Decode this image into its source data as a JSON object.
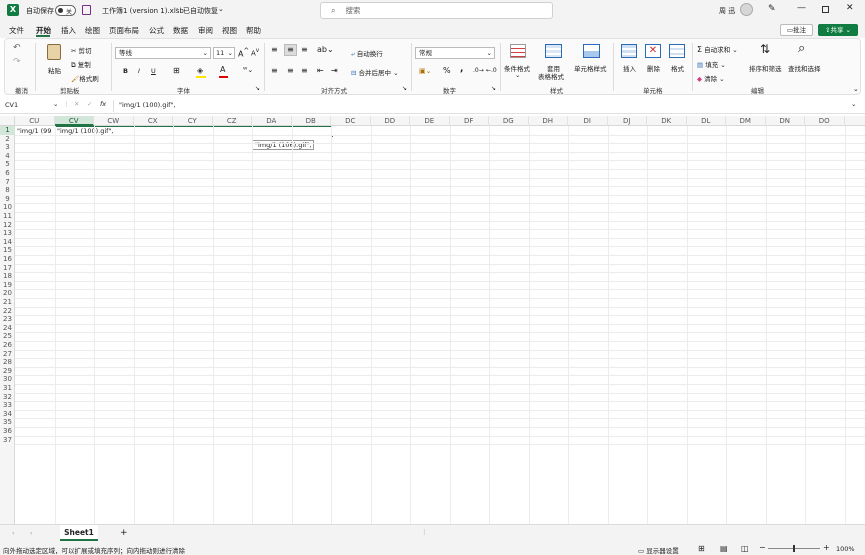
{
  "window": {
    "autosave_label": "自动保存",
    "autosave_state": "关",
    "file_title": "工作簿1 (version 1).xlsb",
    "save_status": "已自动恢复",
    "search_placeholder": "搜索",
    "user_name": "周 迅",
    "user_initial": "周"
  },
  "menu": {
    "items": [
      "文件",
      "开始",
      "插入",
      "绘图",
      "页面布局",
      "公式",
      "数据",
      "审阅",
      "视图",
      "帮助"
    ],
    "active": "开始",
    "comment_label": "批注",
    "share_label": "共享"
  },
  "ribbon": {
    "undo": "撤消",
    "clipboard": {
      "paste": "粘贴",
      "cut": "剪切",
      "copy": "复制",
      "format_painter": "格式刷",
      "label": "剪贴板"
    },
    "font": {
      "name": "等线",
      "size": "11",
      "label": "字体",
      "bold": "B",
      "italic": "I",
      "underline": "U"
    },
    "alignment": {
      "wrap": "自动换行",
      "merge": "合并后居中",
      "label": "对齐方式"
    },
    "number": {
      "format": "常规",
      "label": "数字",
      "percent": "%",
      "comma": ","
    },
    "styles": {
      "cond": "条件格式",
      "table": "套用",
      "table2": "表格格式",
      "cell": "单元格样式",
      "label": "样式"
    },
    "cells": {
      "insert": "插入",
      "delete": "删除",
      "format": "格式",
      "label": "单元格"
    },
    "editing": {
      "autosum": "自动求和",
      "fill": "填充",
      "clear": "清除",
      "sort": "排序和筛选",
      "find": "查找和选择",
      "label": "编辑"
    }
  },
  "formula": {
    "name_box": "CV1",
    "fx": "fx",
    "content": "\"img/1 (100).gif\","
  },
  "grid": {
    "columns": [
      "CU",
      "CV",
      "CW",
      "CX",
      "CY",
      "CZ",
      "DA",
      "DB",
      "DC",
      "DD",
      "DE",
      "DF",
      "DG",
      "DH",
      "DI",
      "DJ",
      "DK",
      "DL",
      "DM",
      "DN",
      "DO"
    ],
    "rows": [
      "1",
      "2",
      "3",
      "4",
      "5",
      "6",
      "7",
      "8",
      "9",
      "10",
      "11",
      "12",
      "13",
      "14",
      "15",
      "16",
      "17",
      "18",
      "19",
      "20",
      "21",
      "22",
      "23",
      "24",
      "25",
      "26",
      "27",
      "28",
      "29",
      "30",
      "31",
      "32",
      "33",
      "34",
      "35",
      "36",
      "37"
    ],
    "cell_cu1": "\"img/1 (99",
    "cell_cv1": "\"img/1 (100).gif\",",
    "fill_tooltip": "\"img/1 (106).gif\","
  },
  "sheets": {
    "tabs": [
      "Sheet1"
    ],
    "add": "+"
  },
  "status": {
    "message": "向外拖动选定区域，可以扩展或填充序列；向内拖动则进行清除",
    "display_settings": "显示器设置",
    "zoom": "100%"
  },
  "colors": {
    "excel_green": "#107c41",
    "accent": "#217346"
  }
}
